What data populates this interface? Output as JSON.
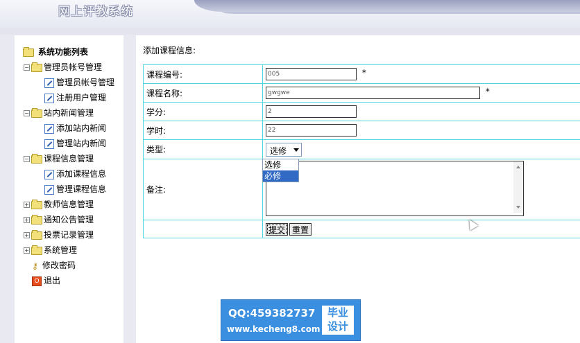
{
  "app": {
    "title": "网上评教系统"
  },
  "sidebar": {
    "root_label": "系统功能列表",
    "groups": [
      {
        "label": "管理员帐号管理",
        "expanded": true,
        "children": [
          "管理员帐号管理",
          "注册用户管理"
        ]
      },
      {
        "label": "站内新闻管理",
        "expanded": true,
        "children": [
          "添加站内新闻",
          "管理站内新闻"
        ]
      },
      {
        "label": "课程信息管理",
        "expanded": true,
        "children": [
          "添加课程信息",
          "管理课程信息"
        ]
      },
      {
        "label": "教师信息管理",
        "expanded": false,
        "children": []
      },
      {
        "label": "通知公告管理",
        "expanded": false,
        "children": []
      },
      {
        "label": "投票记录管理",
        "expanded": false,
        "children": []
      },
      {
        "label": "系统管理",
        "expanded": false,
        "children": []
      }
    ],
    "change_password": "修改密码",
    "logout": "退出"
  },
  "main": {
    "section_title": "添加课程信息:",
    "form": {
      "course_no_label": "课程编号:",
      "course_no_value": "005",
      "course_name_label": "课程名称:",
      "course_name_value": "gwgwe",
      "credit_label": "学分:",
      "credit_value": "2",
      "hours_label": "学时:",
      "hours_value": "22",
      "type_label": "类型:",
      "type_selected": "选修",
      "type_options": [
        "选修",
        "必修"
      ],
      "type_highlighted": "必修",
      "remark_label": "备注:",
      "remark_value": "",
      "required_mark": "*",
      "submit_label": "提交",
      "reset_label": "重置"
    }
  },
  "watermark": {
    "qq": "QQ:459382737",
    "url": "www.kecheng8.com",
    "badge_line1": "毕业",
    "badge_line2": "设计"
  }
}
